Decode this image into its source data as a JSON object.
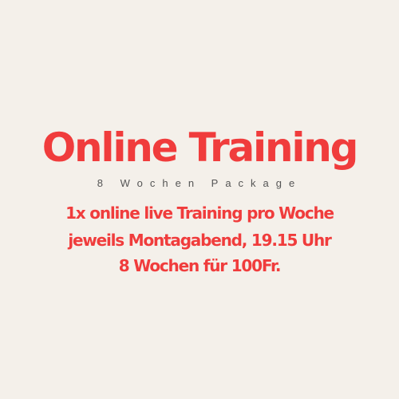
{
  "poster": {
    "title": "Online Training",
    "subtitle": "8 Wochen Package",
    "lines": [
      "1x online live Training pro Woche",
      "jeweils Montagabend, 19.15 Uhr",
      "8 Wochen  für 100Fr."
    ]
  },
  "colors": {
    "background": "#f4f0ea",
    "accent": "#f03c3c",
    "subtitle": "#555555"
  }
}
